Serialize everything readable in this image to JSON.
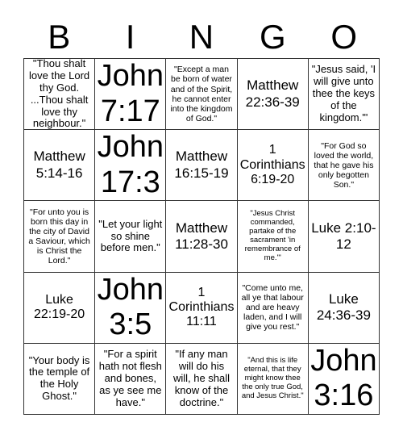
{
  "header": {
    "letters": [
      "B",
      "I",
      "N",
      "G",
      "O"
    ]
  },
  "cells": [
    {
      "text": "\"Thou shalt love the Lord thy God. ...Thou shalt love thy neighbour.\"",
      "size": "md"
    },
    {
      "text": "John 7:17",
      "size": "xl"
    },
    {
      "text": "\"Except a man be born of water and of the Spirit, he cannot enter into the kingdom of God.\"",
      "size": "sm"
    },
    {
      "text": "Matthew 22:36-39",
      "size": "ref"
    },
    {
      "text": "\"Jesus said, 'I will give unto thee the keys of the kingdom.'\"",
      "size": "md"
    },
    {
      "text": "Matthew 5:14-16",
      "size": "ref"
    },
    {
      "text": "John 17:3",
      "size": "xl"
    },
    {
      "text": "Matthew 16:15-19",
      "size": "ref"
    },
    {
      "text": "1 Corinthians 6:19-20",
      "size": "lg"
    },
    {
      "text": "\"For God so loved the world, that he gave his only begotten Son.\"",
      "size": "sm"
    },
    {
      "text": "\"For unto you is born this day in the city of David a Saviour, which is Christ the Lord.\"",
      "size": "sm"
    },
    {
      "text": "\"Let your light so shine before men.\"",
      "size": "md"
    },
    {
      "text": "Matthew 11:28-30",
      "size": "ref"
    },
    {
      "text": "\"Jesus Christ commanded, partake of the sacrament 'in remembrance of me.'\"",
      "size": "xs"
    },
    {
      "text": "Luke 2:10-12",
      "size": "ref"
    },
    {
      "text": "Luke 22:19-20",
      "size": "lg"
    },
    {
      "text": "John 3:5",
      "size": "xl"
    },
    {
      "text": "1 Corinthians 11:11",
      "size": "lg"
    },
    {
      "text": "\"Come unto me, all ye that labour and are heavy laden, and I will give you rest.\"",
      "size": "sm"
    },
    {
      "text": "Luke 24:36-39",
      "size": "ref"
    },
    {
      "text": "\"Your body is the temple of the Holy Ghost.\"",
      "size": "md"
    },
    {
      "text": "\"For a spirit hath not flesh and bones, as ye see me have.\"",
      "size": "md"
    },
    {
      "text": "\"If any man will do his will, he shall know of the doctrine.\"",
      "size": "md"
    },
    {
      "text": "\"And this is life eternal, that they might know thee the only true God, and Jesus Christ.\"",
      "size": "xs"
    },
    {
      "text": "John 3:16",
      "size": "xl"
    }
  ]
}
